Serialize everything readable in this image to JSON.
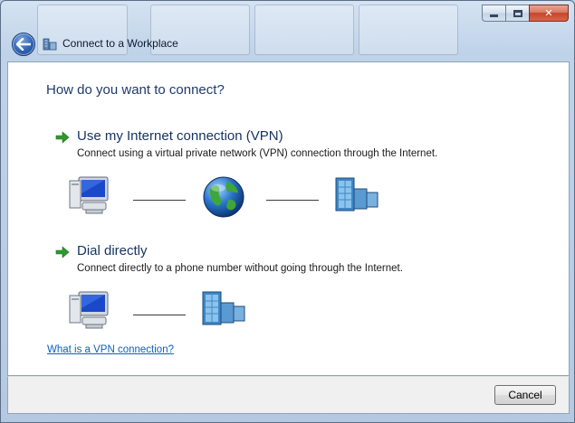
{
  "window": {
    "title": "Connect to a Workplace",
    "caption_buttons": {
      "minimize_icon": "minimize-icon",
      "maximize_icon": "maximize-icon",
      "close_label": "✕"
    }
  },
  "main": {
    "heading": "How do you want to connect?",
    "options": [
      {
        "title": "Use my Internet connection (VPN)",
        "description": "Connect using a virtual private network (VPN) connection through the Internet.",
        "diagram": [
          "computer-icon",
          "globe-icon",
          "workplace-building-icon"
        ]
      },
      {
        "title": "Dial directly",
        "description": "Connect directly to a phone number without going through the Internet.",
        "diagram": [
          "computer-icon",
          "workplace-building-icon"
        ]
      }
    ],
    "help_link": "What is a VPN connection?"
  },
  "footer": {
    "cancel_label": "Cancel"
  },
  "colors": {
    "heading": "#1e3a6e",
    "link": "#0e5fbf",
    "arrow": "#2e9a2e",
    "close_button": "#c7452a"
  }
}
